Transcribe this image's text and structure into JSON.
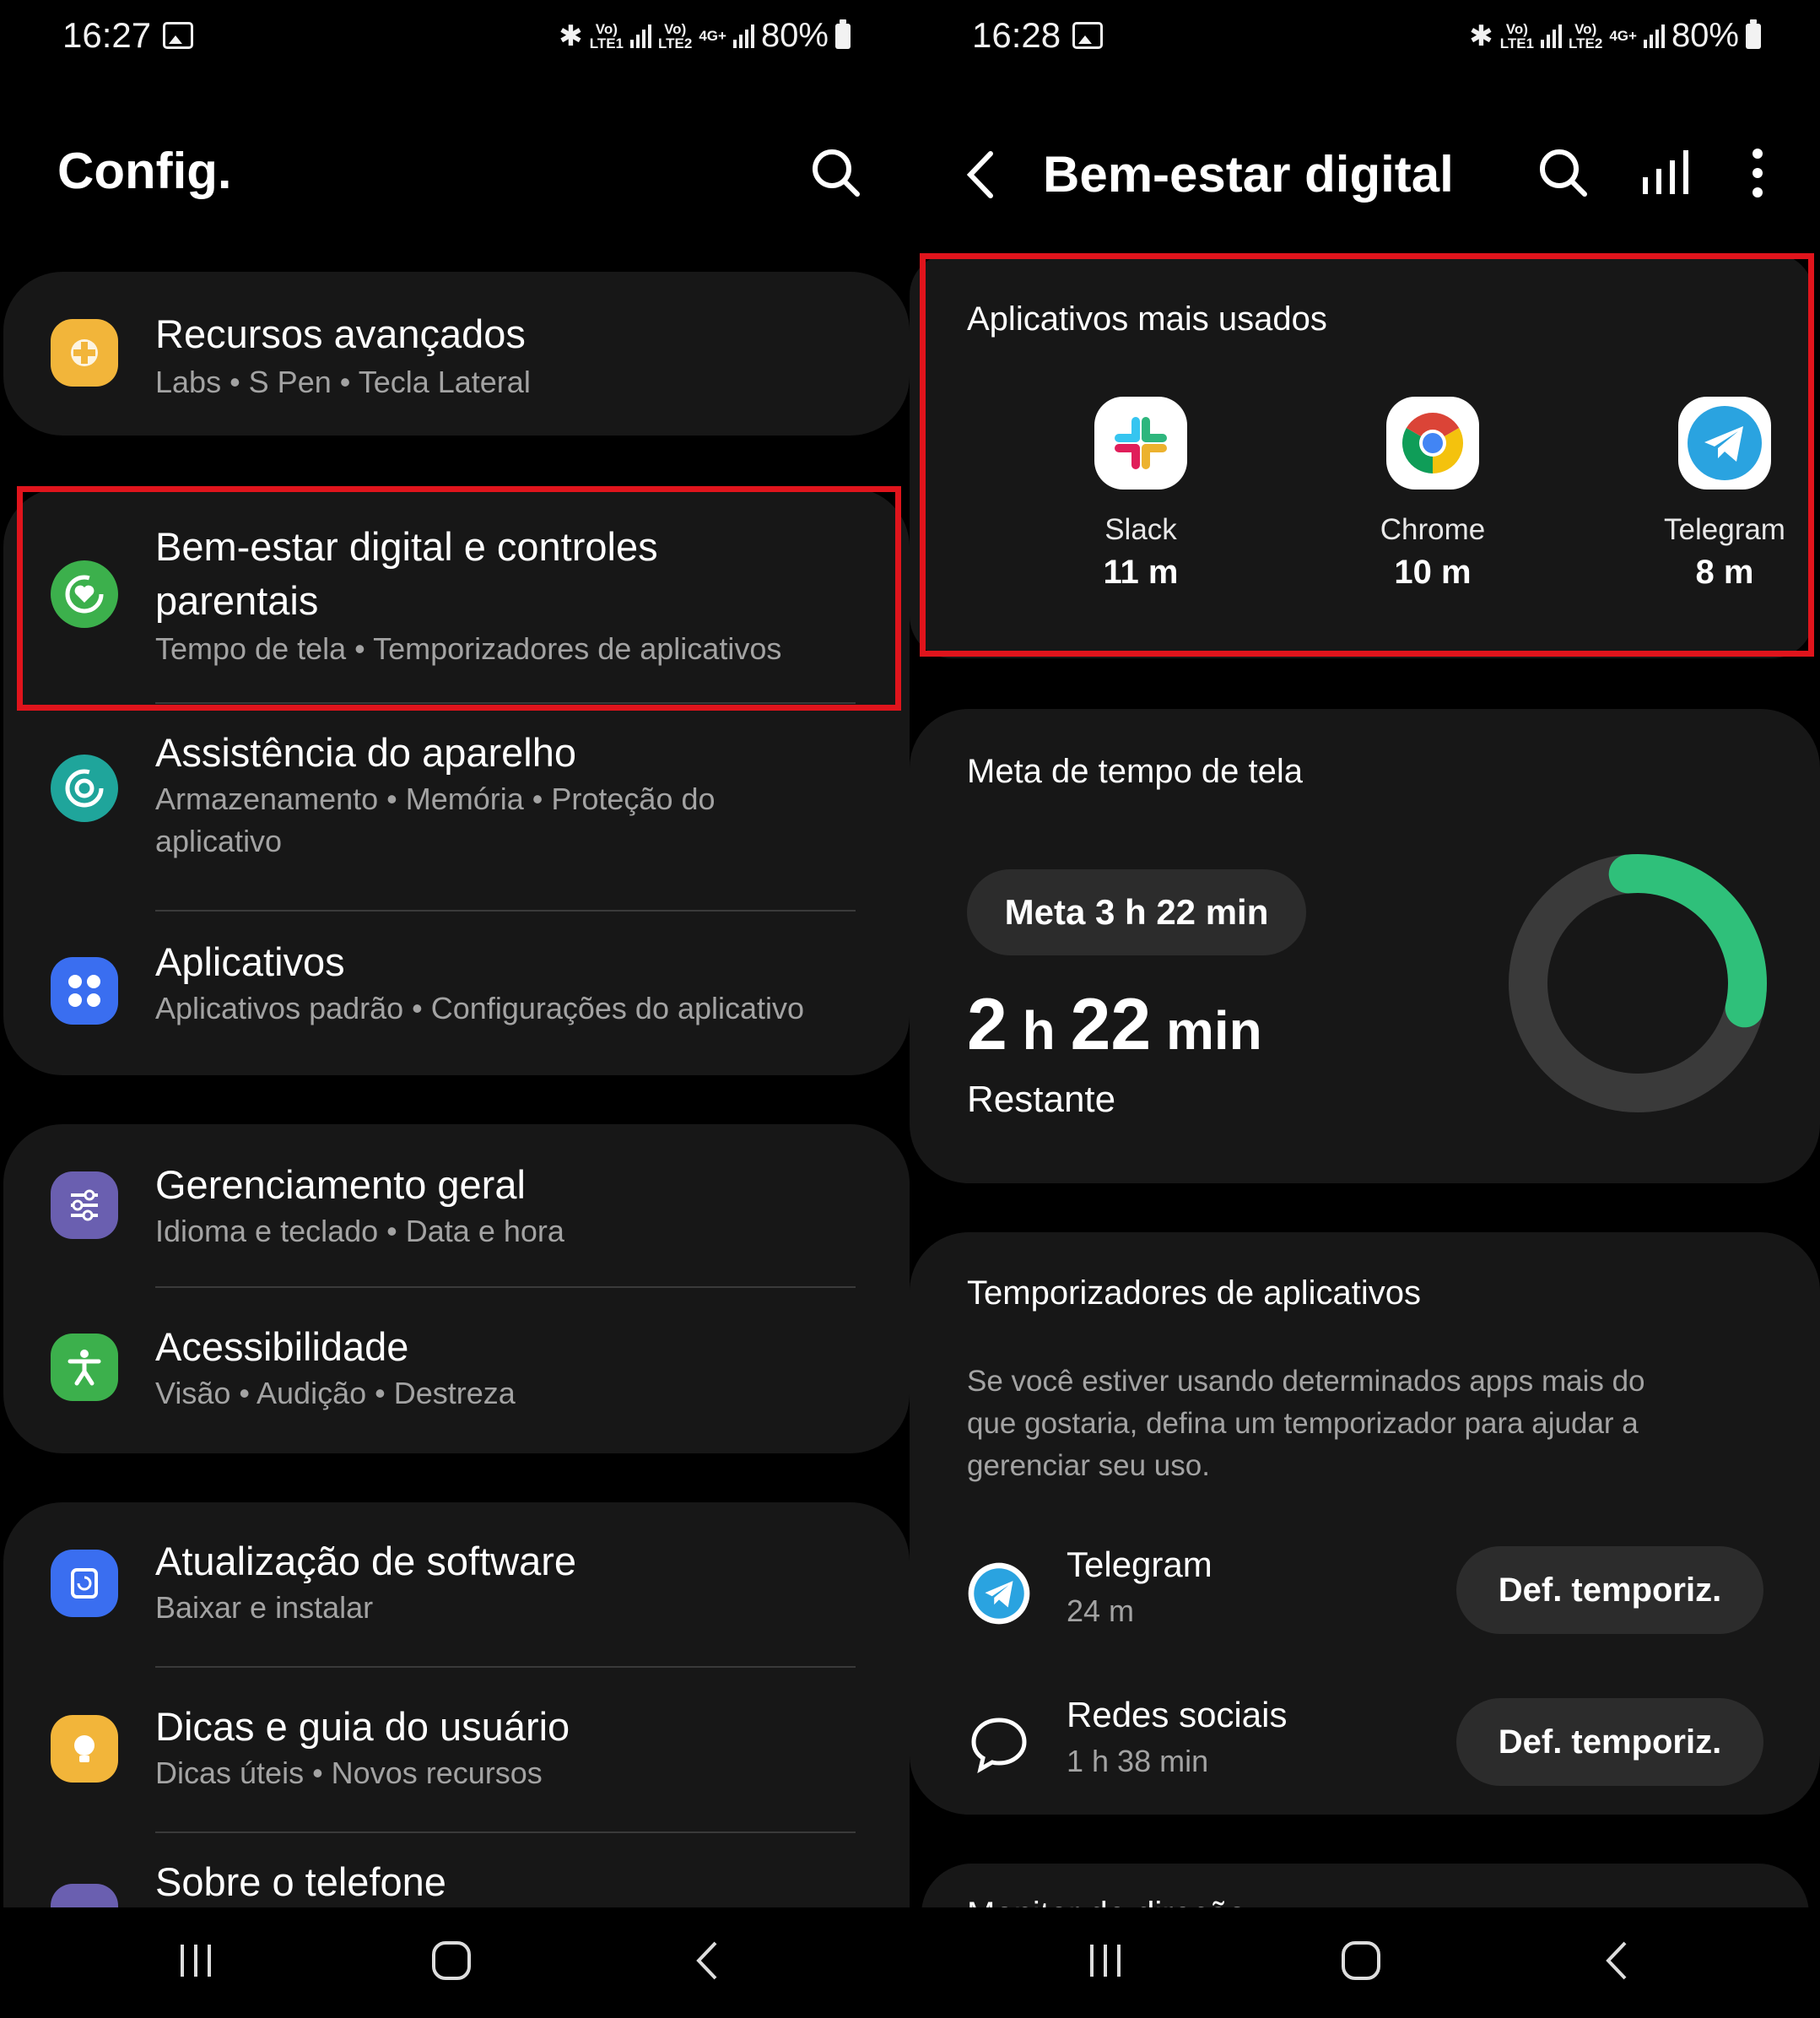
{
  "left": {
    "status": {
      "time": "16:27",
      "battery": "80%",
      "net1": "Vo)\nLTE1",
      "net2": "Vo)\nLTE2",
      "net3": "4G+"
    },
    "header": {
      "title": "Config."
    },
    "groups": [
      {
        "items": [
          {
            "title": "Recursos avançados",
            "subtitle": "Labs  •  S Pen  •  Tecla Lateral",
            "icon": "puzzle-gear-icon",
            "color": "#f2b53a"
          }
        ]
      },
      {
        "items": [
          {
            "title": "Bem-estar digital e controles",
            "title2": "parentais",
            "subtitle": "Tempo de tela  •  Temporizadores de aplicativos",
            "icon": "heart-circle-icon",
            "color": "#3cb04c"
          },
          {
            "title": "Assistência do aparelho",
            "subtitle": "Armazenamento  •  Memória  •  Proteção do",
            "subtitle2": "aplicativo",
            "icon": "device-care-icon",
            "color": "#1fa59b"
          },
          {
            "title": "Aplicativos",
            "subtitle": "Aplicativos padrão  •  Configurações do aplicativo",
            "icon": "apps-grid-icon",
            "color": "#3a6ef0"
          }
        ]
      },
      {
        "items": [
          {
            "title": "Gerenciamento geral",
            "subtitle": "Idioma e teclado  •  Data e hora",
            "icon": "sliders-icon",
            "color": "#6a5fb0"
          },
          {
            "title": "Acessibilidade",
            "subtitle": "Visão  •  Audição  •  Destreza",
            "icon": "accessibility-icon",
            "color": "#3cb04c"
          }
        ]
      },
      {
        "items": [
          {
            "title": "Atualização de software",
            "subtitle": "Baixar e instalar",
            "icon": "software-update-icon",
            "color": "#3a6ef0"
          },
          {
            "title": "Dicas e guia do usuário",
            "subtitle": "Dicas úteis  •  Novos recursos",
            "icon": "lightbulb-icon",
            "color": "#f2b53a"
          },
          {
            "title": "Sobre o telefone",
            "icon": "info-icon",
            "color": "#6a5fb0"
          }
        ]
      }
    ]
  },
  "right": {
    "status": {
      "time": "16:28",
      "battery": "80%",
      "net1": "Vo)\nLTE1",
      "net2": "Vo)\nLTE2",
      "net3": "4G+"
    },
    "header": {
      "title": "Bem-estar digital"
    },
    "most_used": {
      "title": "Aplicativos mais usados",
      "apps": [
        {
          "name": "Slack",
          "time": "11 m",
          "icon": "slack-icon"
        },
        {
          "name": "Chrome",
          "time": "10 m",
          "icon": "chrome-icon"
        },
        {
          "name": "Telegram",
          "time": "8 m",
          "icon": "telegram-icon"
        }
      ]
    },
    "goal": {
      "title": "Meta de tempo de tela",
      "goal_label": "Meta 3 h 22 min",
      "remaining_num1": "2",
      "remaining_unit1": "h",
      "remaining_num2": "22",
      "remaining_unit2": "min",
      "remaining_label": "Restante",
      "progress_fraction": 0.3,
      "ring_color": "#2fc07a",
      "track_color": "#3a3a3a"
    },
    "timers": {
      "title": "Temporizadores de aplicativos",
      "desc1": "Se você estiver usando determinados apps mais do",
      "desc2": "que gostaria, defina um temporizador para ajudar a",
      "desc3": "gerenciar seu uso.",
      "items": [
        {
          "name": "Telegram",
          "time": "24 m",
          "button": "Def. temporiz.",
          "icon": "telegram-icon"
        },
        {
          "name": "Redes sociais",
          "time": "1 h 38 min",
          "button": "Def. temporiz.",
          "icon": "chat-bubble-icon"
        }
      ]
    },
    "next_card_partial": "Monitor de direção"
  },
  "colors": {
    "highlight": "#e0141c",
    "card": "#171717",
    "background": "#000000"
  }
}
